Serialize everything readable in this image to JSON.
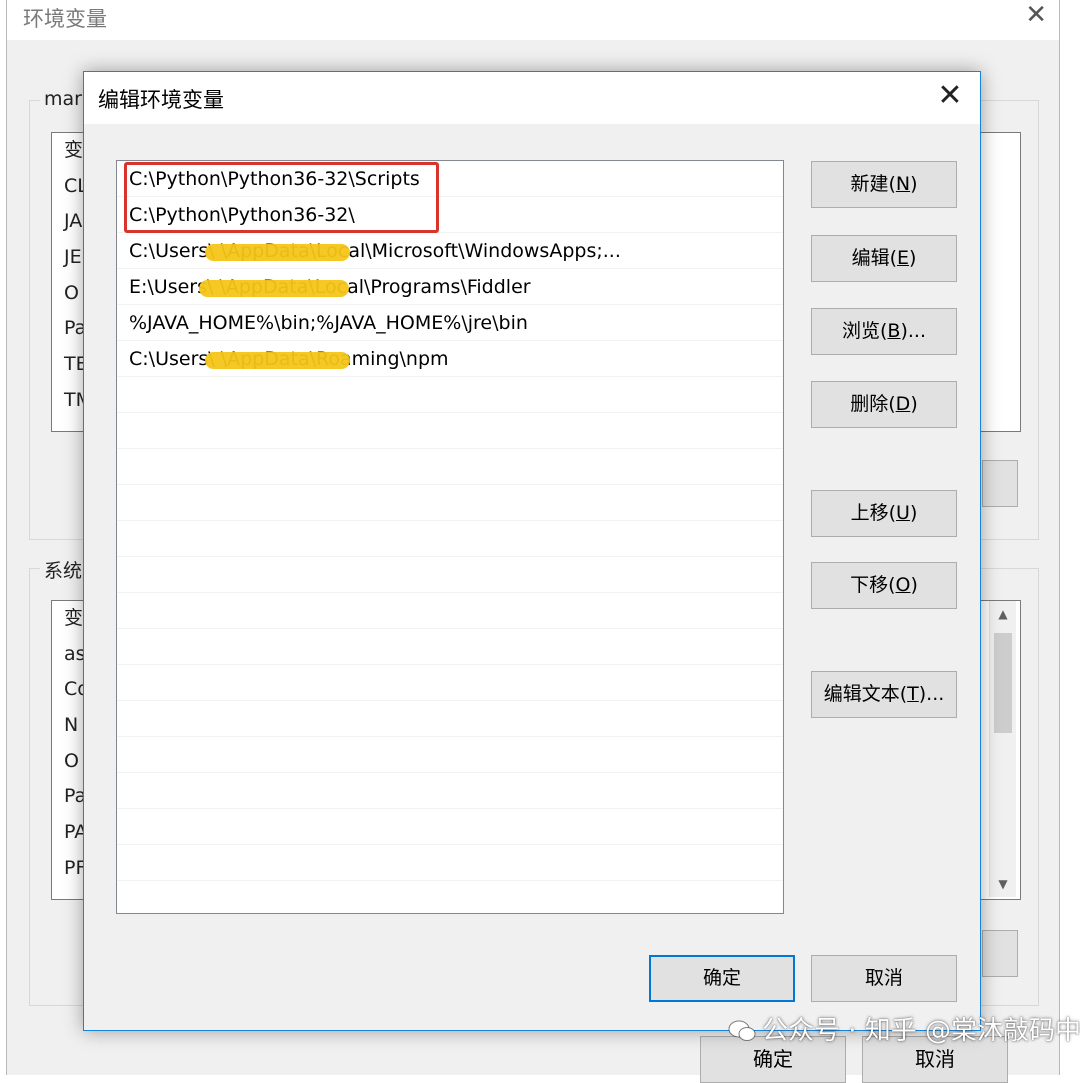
{
  "background_window": {
    "title": "环境变量",
    "close_glyph": "✕",
    "user_group_label": "mar",
    "user_vars": [
      "变",
      "CL",
      "JA",
      "JE",
      "O",
      "Pa",
      "TE",
      "TM"
    ],
    "system_group_label": "系统",
    "system_vars": [
      "变",
      "as",
      "Co",
      "N",
      "O",
      "Pa",
      "PA",
      "PF"
    ],
    "ok_label": "确定",
    "cancel_label": "取消"
  },
  "dialog": {
    "title": "编辑环境变量",
    "close_glyph": "✕",
    "paths": [
      "C:\\Python\\Python36-32\\Scripts",
      "C:\\Python\\Python36-32\\",
      "C:\\Users\\                    \\AppData\\Local\\Microsoft\\WindowsApps;...",
      "E:\\Users\\                    \\AppData\\Local\\Programs\\Fiddler",
      "%JAVA_HOME%\\bin;%JAVA_HOME%\\jre\\bin",
      "C:\\Users\\                    \\AppData\\Roaming\\npm"
    ],
    "buttons": {
      "new_label": "新建(",
      "new_key": "N",
      "edit_label": "编辑(",
      "edit_key": "E",
      "browse_label": "浏览(",
      "browse_key": "B",
      "browse_suffix": ")...",
      "delete_label": "删除(",
      "delete_key": "D",
      "move_up_label": "上移(",
      "move_up_key": "U",
      "move_down_label": "下移(",
      "move_down_key": "O",
      "edit_text_label": "编辑文本(",
      "edit_text_key": "T",
      "edit_text_suffix": ")...",
      "close_paren": ")"
    },
    "ok_label": "确定",
    "cancel_label": "取消"
  },
  "watermark": {
    "text": "公众号 · 知乎 @棠沐敲码中"
  },
  "colors": {
    "highlight_border": "#d9342b",
    "redaction": "#f5c518",
    "accent": "#0078d7"
  }
}
